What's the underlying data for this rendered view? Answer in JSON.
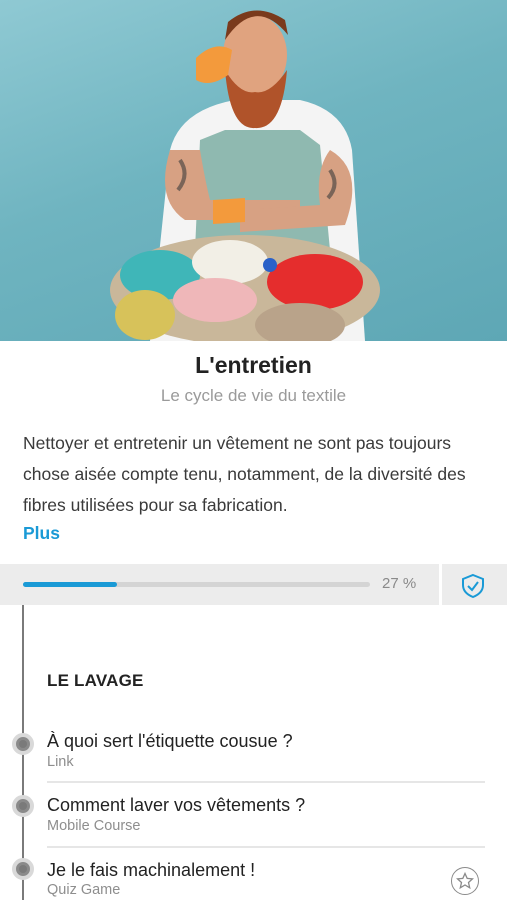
{
  "hero": {
    "image_name": "man-with-laundry-basket"
  },
  "header": {
    "title": "L'entretien",
    "subtitle": "Le cycle de vie du textile"
  },
  "description": {
    "text": "Nettoyer et entretenir un vêtement ne sont pas toujours chose aisée compte tenu, notamment, de la diversité des fibres utilisées pour sa fabrication.",
    "more_label": "Plus"
  },
  "progress": {
    "percent": 27,
    "label": "27 %",
    "icon": "shield-check-icon"
  },
  "section": {
    "title": "LE LAVAGE",
    "items": [
      {
        "title": "À quoi sert l'étiquette cousue ?",
        "type": "Link"
      },
      {
        "title": "Comment laver vos vêtements ?",
        "type": "Mobile Course"
      },
      {
        "title": "Je le fais machinalement !",
        "type": "Quiz Game",
        "icon": "star-icon"
      }
    ]
  },
  "colors": {
    "accent": "#1a9ad6",
    "strip": "#ececec",
    "timeline": "#7a7a7a"
  }
}
